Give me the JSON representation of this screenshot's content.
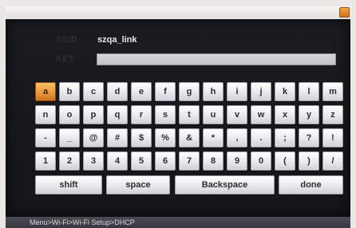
{
  "fields": {
    "ssid_label": "SSID",
    "ssid_value": "szqa_link",
    "key_label": "KEY",
    "key_value": ""
  },
  "keyboard": {
    "rows": [
      [
        "a",
        "b",
        "c",
        "d",
        "e",
        "f",
        "g",
        "h",
        "i",
        "j",
        "k",
        "l",
        "m"
      ],
      [
        "n",
        "o",
        "p",
        "q",
        "r",
        "s",
        "t",
        "u",
        "v",
        "w",
        "x",
        "y",
        "z"
      ],
      [
        "-",
        "_",
        "@",
        "#",
        "$",
        "%",
        "&",
        "*",
        ",",
        ".",
        ";",
        "?",
        "!"
      ],
      [
        "1",
        "2",
        "3",
        "4",
        "5",
        "6",
        "7",
        "8",
        "9",
        "0",
        "(",
        ")",
        "/"
      ]
    ],
    "active_key": "a",
    "shift_label": "shift",
    "space_label": "space",
    "backspace_label": "Backspace",
    "done_label": "done"
  },
  "status": {
    "breadcrumb": "Menu>Wi-Fi>Wi-Fi Setup>DHCP"
  },
  "colors": {
    "screen_bg": "#18191e",
    "key_face": "#e8e9ec",
    "active_key": "#eb9b3c"
  },
  "icons": {
    "corner": "orange-square-icon"
  }
}
